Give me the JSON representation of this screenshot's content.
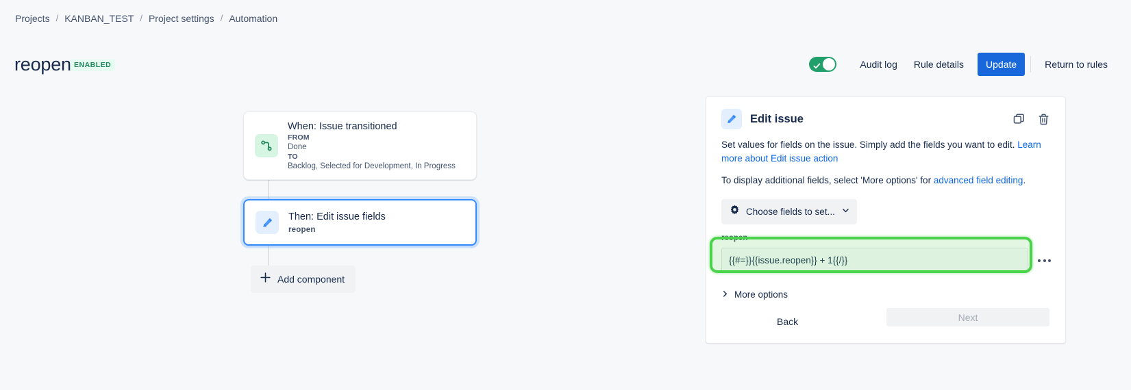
{
  "breadcrumb": {
    "items": [
      "Projects",
      "KANBAN_TEST",
      "Project settings",
      "Automation"
    ],
    "separator": "/"
  },
  "header": {
    "rule_name": "reopen",
    "status_badge": "ENABLED",
    "toggle_on": true,
    "audit_log_label": "Audit log",
    "rule_details_label": "Rule details",
    "update_label": "Update",
    "return_label": "Return to rules",
    "accent_blue": "#1868db",
    "toggle_green": "#22a06b"
  },
  "canvas": {
    "trigger": {
      "title": "When: Issue transitioned",
      "from_label": "FROM",
      "from_value": "Done",
      "to_label": "TO",
      "to_value": "Backlog, Selected for Development, In Progress",
      "icon": "issue-transitioned-icon",
      "icon_bg": "#d6f5e3"
    },
    "action": {
      "title": "Then: Edit issue fields",
      "subtitle": "reopen",
      "icon": "pencil-icon",
      "icon_bg": "#e4effd",
      "selected": true
    },
    "add_component_label": "Add component"
  },
  "panel": {
    "title": "Edit issue",
    "icon": "pencil-icon",
    "copy_icon": "copy-icon",
    "delete_icon": "trash-icon",
    "description_1_text": "Set values for fields on the issue. Simply add the fields you want to edit. ",
    "description_1_link": "Learn more about Edit issue action",
    "description_2_prefix": "To display additional fields, select 'More options' for ",
    "description_2_link": "advanced field editing",
    "description_2_suffix": ".",
    "choose_fields_label": "Choose fields to set...",
    "choose_fields_icon": "gear-icon",
    "chevron_icon": "chevron-down-icon",
    "field_label": "reopen",
    "field_value": "{{#=}}{{issue.reopen}} + 1{{/}}",
    "field_placeholder": "",
    "more_menu_icon": "more-horizontal-icon",
    "more_options_label": "More options",
    "more_options_icon": "chevron-right-icon",
    "back_label": "Back",
    "next_label": "Next",
    "next_disabled": true,
    "highlight_color": "#4cd34c"
  }
}
